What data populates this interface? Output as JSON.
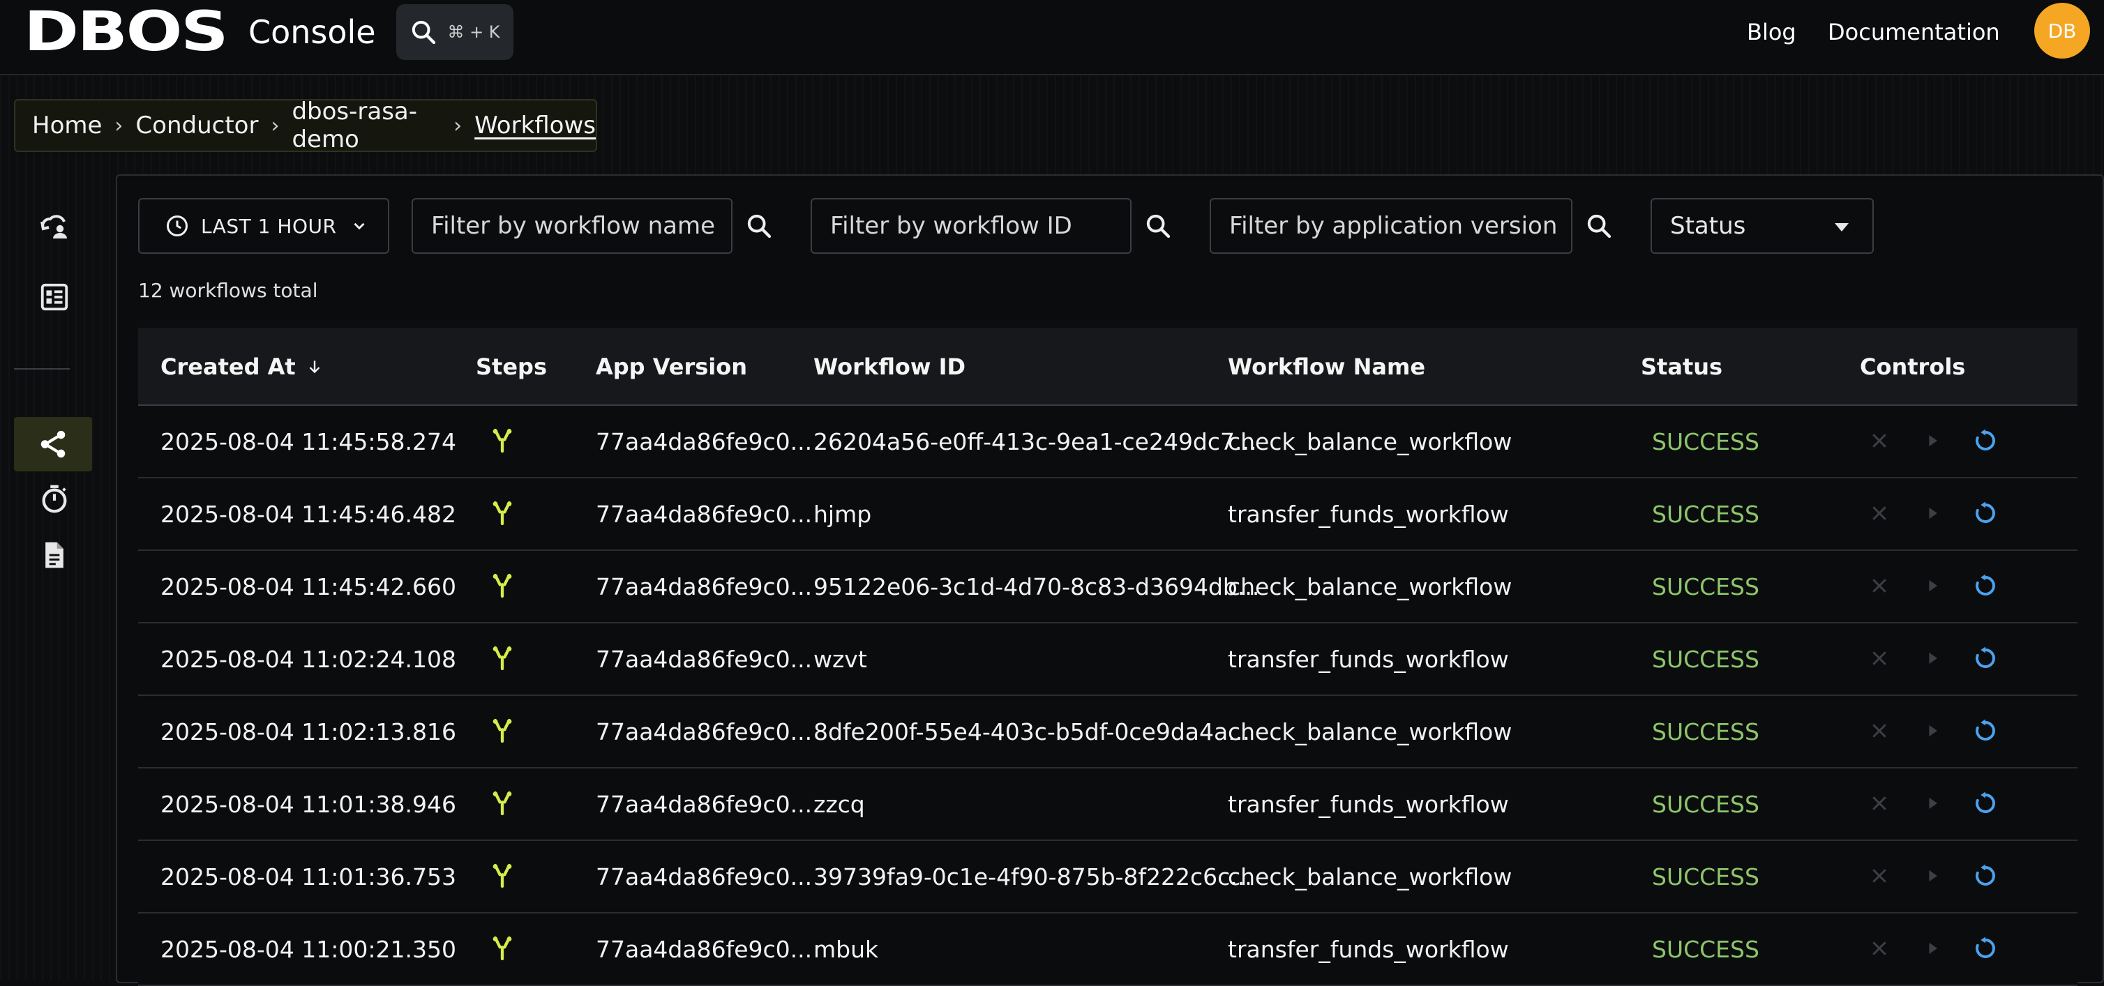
{
  "brand": {
    "logo_text": "DBOS",
    "app_title": "Console"
  },
  "search": {
    "shortcut": "⌘ + K",
    "icon": "search-icon"
  },
  "nav": {
    "blog": "Blog",
    "documentation": "Documentation"
  },
  "user": {
    "initials": "DB",
    "avatar_color": "#f5a623"
  },
  "breadcrumb": [
    "Home",
    "Conductor",
    "dbos-rasa-demo",
    "Workflows"
  ],
  "sidebar": {
    "items": [
      {
        "icon": "cloud-user-icon",
        "active": false
      },
      {
        "icon": "dashboard-icon",
        "active": false
      },
      {
        "icon": "workflows-share-icon",
        "active": true
      },
      {
        "icon": "timer-icon",
        "active": false
      },
      {
        "icon": "document-icon",
        "active": false
      }
    ]
  },
  "filters": {
    "time_range": "LAST 1 HOUR",
    "workflow_name_placeholder": "Filter by workflow name",
    "workflow_id_placeholder": "Filter by workflow ID",
    "app_version_placeholder": "Filter by application version",
    "status_label": "Status"
  },
  "summary": {
    "total_text": "12 workflows total"
  },
  "table": {
    "columns": [
      "Created At",
      "Steps",
      "App Version",
      "Workflow ID",
      "Workflow Name",
      "Status",
      "Controls"
    ],
    "rows": [
      {
        "created_at": "2025-08-04 11:45:58.274",
        "app_version": "77aa4da86fe9c0...",
        "workflow_id": "26204a56-e0ff-413c-9ea1-ce249dc7...",
        "workflow_name": "check_balance_workflow",
        "status": "SUCCESS"
      },
      {
        "created_at": "2025-08-04 11:45:46.482",
        "app_version": "77aa4da86fe9c0...",
        "workflow_id": "hjmp",
        "workflow_name": "transfer_funds_workflow",
        "status": "SUCCESS"
      },
      {
        "created_at": "2025-08-04 11:45:42.660",
        "app_version": "77aa4da86fe9c0...",
        "workflow_id": "95122e06-3c1d-4d70-8c83-d3694db...",
        "workflow_name": "check_balance_workflow",
        "status": "SUCCESS"
      },
      {
        "created_at": "2025-08-04 11:02:24.108",
        "app_version": "77aa4da86fe9c0...",
        "workflow_id": "wzvt",
        "workflow_name": "transfer_funds_workflow",
        "status": "SUCCESS"
      },
      {
        "created_at": "2025-08-04 11:02:13.816",
        "app_version": "77aa4da86fe9c0...",
        "workflow_id": "8dfe200f-55e4-403c-b5df-0ce9da4a...",
        "workflow_name": "check_balance_workflow",
        "status": "SUCCESS"
      },
      {
        "created_at": "2025-08-04 11:01:38.946",
        "app_version": "77aa4da86fe9c0...",
        "workflow_id": "zzcq",
        "workflow_name": "transfer_funds_workflow",
        "status": "SUCCESS"
      },
      {
        "created_at": "2025-08-04 11:01:36.753",
        "app_version": "77aa4da86fe9c0...",
        "workflow_id": "39739fa9-0c1e-4f90-875b-8f222c6c...",
        "workflow_name": "check_balance_workflow",
        "status": "SUCCESS"
      },
      {
        "created_at": "2025-08-04 11:00:21.350",
        "app_version": "77aa4da86fe9c0...",
        "workflow_id": "mbuk",
        "workflow_name": "transfer_funds_workflow",
        "status": "SUCCESS"
      }
    ]
  },
  "colors": {
    "success": "#8cc66a",
    "steps_icon": "#d6ec4a",
    "restart_icon": "#4aa3f0",
    "disabled_control": "#3c3f44"
  }
}
